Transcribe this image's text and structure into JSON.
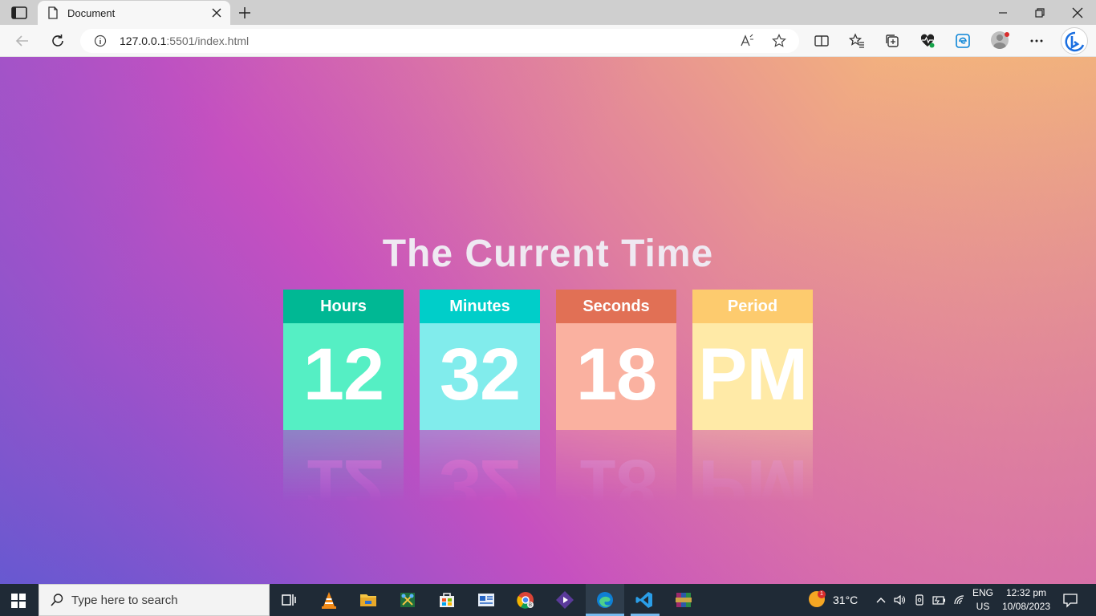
{
  "browser": {
    "tab_title": "Document",
    "url_host": "127.0.0.1",
    "url_rest": ":5501/index.html"
  },
  "page": {
    "heading": "The Current Time",
    "cards": [
      {
        "label": "Hours",
        "value": "12",
        "header_color": "#00b894",
        "body_color": "#55efc4"
      },
      {
        "label": "Minutes",
        "value": "32",
        "header_color": "#00cec9",
        "body_color": "#81ecec"
      },
      {
        "label": "Seconds",
        "value": "18",
        "header_color": "#e17055",
        "body_color": "#fab1a0"
      },
      {
        "label": "Period",
        "value": "PM",
        "header_color": "#fdcb6e",
        "body_color": "#ffeaa7"
      }
    ]
  },
  "taskbar": {
    "search_placeholder": "Type here to search",
    "weather_temp": "31°C",
    "weather_badge": "1",
    "lang_top": "ENG",
    "lang_bottom": "US",
    "clock_time": "12:32 pm",
    "clock_date": "10/08/2023"
  }
}
